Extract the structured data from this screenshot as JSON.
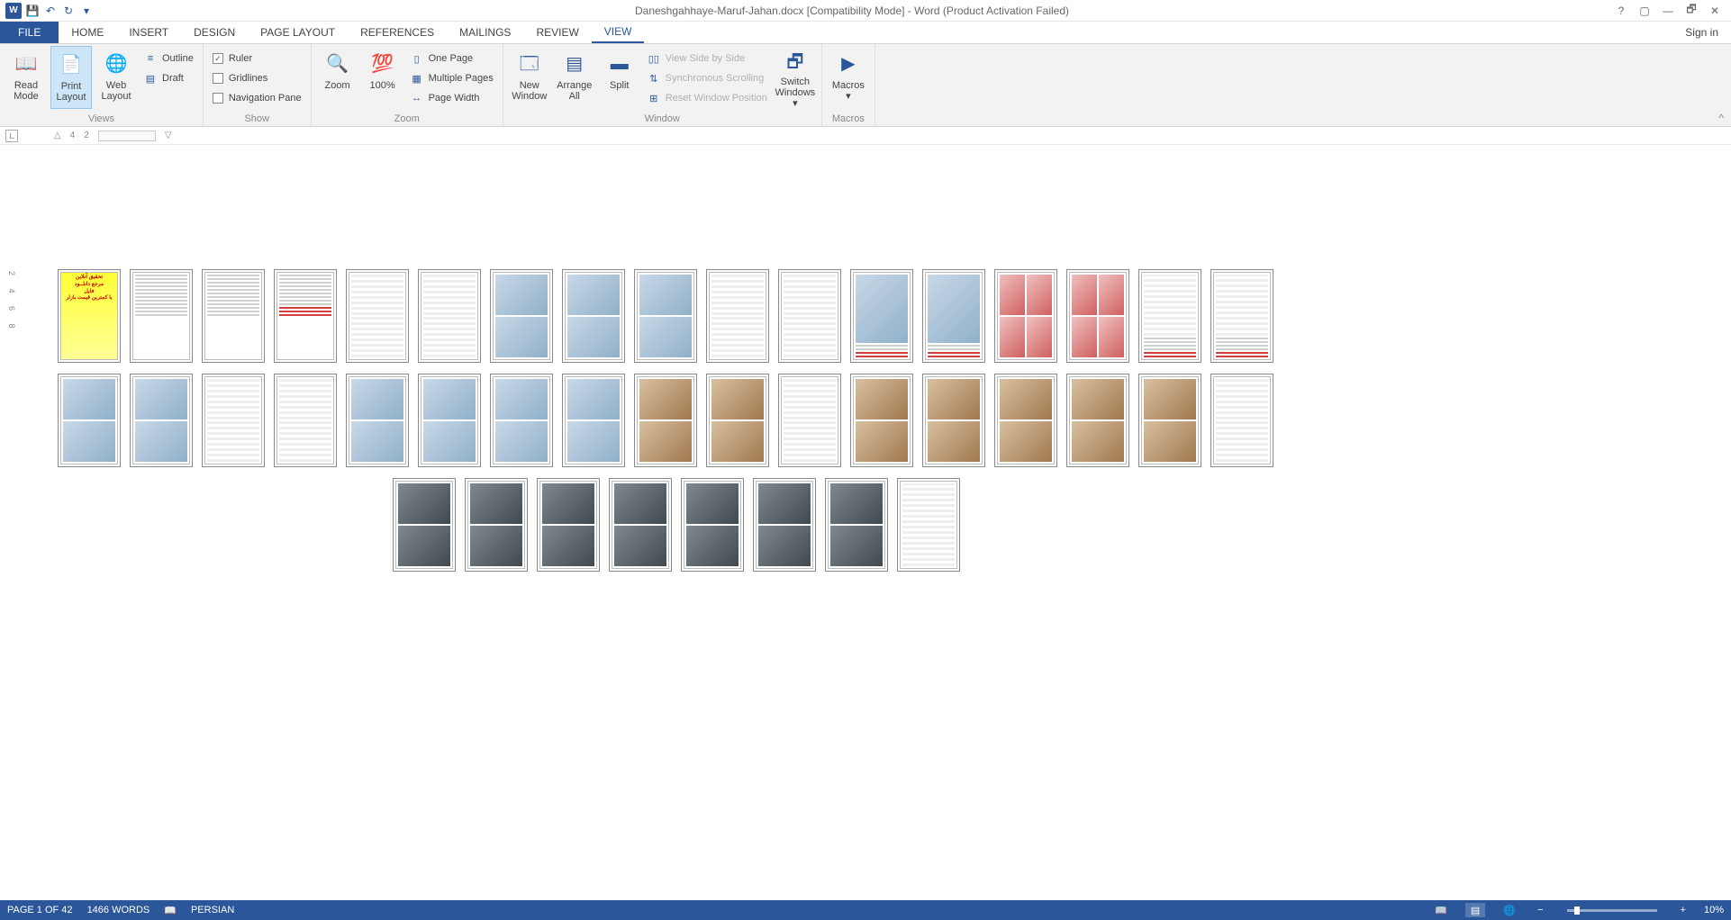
{
  "titlebar": {
    "title": "Daneshgahhaye-Maruf-Jahan.docx [Compatibility Mode] - Word (Product Activation Failed)"
  },
  "qat": {
    "save": "💾",
    "undo": "↶",
    "redo": "↻"
  },
  "winbuttons": {
    "help": "?",
    "ribbon": "▢",
    "min": "—",
    "restore": "🗗",
    "close": "✕"
  },
  "tabs": {
    "file": "FILE",
    "home": "HOME",
    "insert": "INSERT",
    "design": "DESIGN",
    "page_layout": "PAGE LAYOUT",
    "references": "REFERENCES",
    "mailings": "MAILINGS",
    "review": "REVIEW",
    "view": "VIEW",
    "sign_in": "Sign in"
  },
  "ribbon": {
    "views": {
      "label": "Views",
      "read_mode": "Read Mode",
      "print_layout": "Print Layout",
      "web_layout": "Web Layout",
      "outline": "Outline",
      "draft": "Draft"
    },
    "show": {
      "label": "Show",
      "ruler": {
        "label": "Ruler",
        "checked": true
      },
      "gridlines": {
        "label": "Gridlines",
        "checked": false
      },
      "navigation_pane": {
        "label": "Navigation Pane",
        "checked": false
      }
    },
    "zoom": {
      "label": "Zoom",
      "zoom_btn": "Zoom",
      "hundred": "100%",
      "one_page": "One Page",
      "multiple_pages": "Multiple Pages",
      "page_width": "Page Width"
    },
    "window": {
      "label": "Window",
      "new_window": "New Window",
      "arrange_all": "Arrange All",
      "split": "Split",
      "view_side": "View Side by Side",
      "sync_scroll": "Synchronous Scrolling",
      "reset_pos": "Reset Window Position",
      "switch": "Switch Windows"
    },
    "macros": {
      "label": "Macros",
      "btn": "Macros"
    }
  },
  "ruler": {
    "tabind": "L",
    "n1": "4",
    "n2": "2",
    "vnums": "2   4   6   8"
  },
  "status": {
    "page": "PAGE 1 OF 42",
    "words": "1466 WORDS",
    "lang": "PERSIAN",
    "zoom_minus": "−",
    "zoom_plus": "+",
    "zoom_value": "10%"
  },
  "page_count": 42
}
